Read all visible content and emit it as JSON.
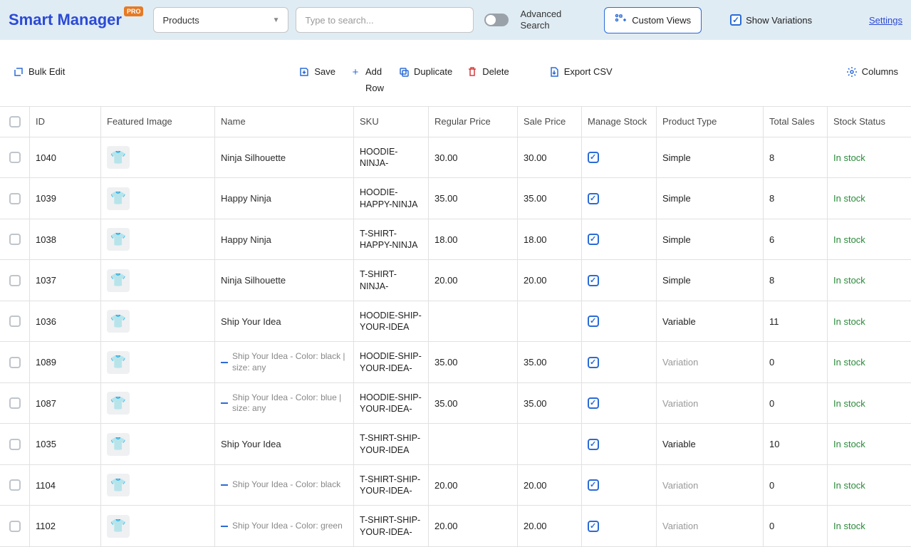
{
  "header": {
    "brand": "Smart Manager",
    "pro": "PRO",
    "dashboard_select": "Products",
    "search_placeholder": "Type to search...",
    "advanced": "Advanced",
    "search_word": "Search",
    "custom_views": "Custom Views",
    "show_variations": "Show Variations",
    "settings": "Settings"
  },
  "actions": {
    "bulk_edit": "Bulk Edit",
    "save": "Save",
    "add": "Add",
    "row": "Row",
    "duplicate": "Duplicate",
    "delete": "Delete",
    "export_csv": "Export CSV",
    "columns": "Columns"
  },
  "columns": {
    "id": "ID",
    "featured_image": "Featured Image",
    "name": "Name",
    "sku": "SKU",
    "regular_price": "Regular Price",
    "sale_price": "Sale Price",
    "manage_stock": "Manage Stock",
    "product_type": "Product Type",
    "total_sales": "Total Sales",
    "stock_status": "Stock Status"
  },
  "rows": [
    {
      "id": "1040",
      "thumb": "👕",
      "thumb_bg": "#2b2b2b",
      "name": "Ninja Silhouette",
      "variation": false,
      "sku": "HOODIE-NINJA-",
      "regular_price": "30.00",
      "sale_price": "30.00",
      "manage_stock": true,
      "product_type": "Simple",
      "pt_grey": false,
      "total_sales": "8",
      "stock_status": "In stock"
    },
    {
      "id": "1039",
      "thumb": "👕",
      "thumb_bg": "#f1f1f1",
      "name": "Happy Ninja",
      "variation": false,
      "sku": "HOODIE-HAPPY-NINJA",
      "regular_price": "35.00",
      "sale_price": "35.00",
      "manage_stock": true,
      "product_type": "Simple",
      "pt_grey": false,
      "total_sales": "8",
      "stock_status": "In stock"
    },
    {
      "id": "1038",
      "thumb": "👕",
      "thumb_bg": "#e9e9e9",
      "name": "Happy Ninja",
      "variation": false,
      "sku": "T-SHIRT-HAPPY-NINJA",
      "regular_price": "18.00",
      "sale_price": "18.00",
      "manage_stock": true,
      "product_type": "Simple",
      "pt_grey": false,
      "total_sales": "6",
      "stock_status": "In stock"
    },
    {
      "id": "1037",
      "thumb": "👕",
      "thumb_bg": "#1a1a1a",
      "name": "Ninja Silhouette",
      "variation": false,
      "sku": "T-SHIRT-NINJA-",
      "regular_price": "20.00",
      "sale_price": "20.00",
      "manage_stock": true,
      "product_type": "Simple",
      "pt_grey": false,
      "total_sales": "8",
      "stock_status": "In stock"
    },
    {
      "id": "1036",
      "thumb": "👕",
      "thumb_bg": "#2b2b2b",
      "name": "Ship Your Idea",
      "variation": false,
      "sku": "HOODIE-SHIP-YOUR-IDEA",
      "regular_price": "",
      "sale_price": "",
      "manage_stock": true,
      "product_type": "Variable",
      "pt_grey": false,
      "total_sales": "11",
      "stock_status": "In stock"
    },
    {
      "id": "1089",
      "thumb": "👕",
      "thumb_bg": "#2b2b2b",
      "name": "Ship Your Idea - Color: black | size: any",
      "variation": true,
      "sku": "HOODIE-SHIP-YOUR-IDEA-",
      "regular_price": "35.00",
      "sale_price": "35.00",
      "manage_stock": true,
      "product_type": "Variation",
      "pt_grey": true,
      "total_sales": "0",
      "stock_status": "In stock"
    },
    {
      "id": "1087",
      "thumb": "👕",
      "thumb_bg": "#1f5fc2",
      "name": "Ship Your Idea - Color: blue | size: any",
      "variation": true,
      "sku": "HOODIE-SHIP-YOUR-IDEA-",
      "regular_price": "35.00",
      "sale_price": "35.00",
      "manage_stock": true,
      "product_type": "Variation",
      "pt_grey": true,
      "total_sales": "0",
      "stock_status": "In stock"
    },
    {
      "id": "1035",
      "thumb": "👕",
      "thumb_bg": "#1a1a1a",
      "name": "Ship Your Idea",
      "variation": false,
      "sku": "T-SHIRT-SHIP-YOUR-IDEA",
      "regular_price": "",
      "sale_price": "",
      "manage_stock": true,
      "product_type": "Variable",
      "pt_grey": false,
      "total_sales": "10",
      "stock_status": "In stock"
    },
    {
      "id": "1104",
      "thumb": "👕",
      "thumb_bg": "#1a1a1a",
      "name": "Ship Your Idea - Color: black",
      "variation": true,
      "sku": "T-SHIRT-SHIP-YOUR-IDEA-",
      "regular_price": "20.00",
      "sale_price": "20.00",
      "manage_stock": true,
      "product_type": "Variation",
      "pt_grey": true,
      "total_sales": "0",
      "stock_status": "In stock"
    },
    {
      "id": "1102",
      "thumb": "👕",
      "thumb_bg": "#4a7a3a",
      "name": "Ship Your Idea - Color: green",
      "variation": true,
      "sku": "T-SHIRT-SHIP-YOUR-IDEA-",
      "regular_price": "20.00",
      "sale_price": "20.00",
      "manage_stock": true,
      "product_type": "Variation",
      "pt_grey": true,
      "total_sales": "0",
      "stock_status": "In stock"
    }
  ]
}
